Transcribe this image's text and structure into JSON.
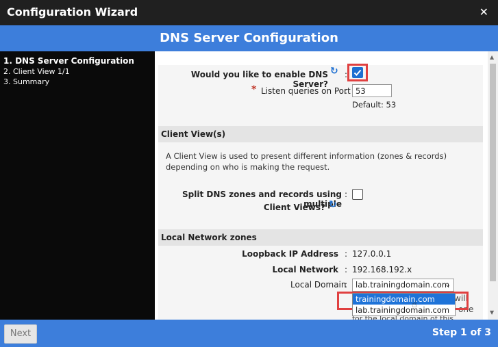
{
  "window": {
    "title": "Configuration Wizard",
    "close_glyph": "✕"
  },
  "header": {
    "title": "DNS Server Configuration"
  },
  "sidebar": {
    "steps": [
      {
        "label": "1.  DNS Server Configuration"
      },
      {
        "label": "2. Client View 1/1"
      },
      {
        "label": "3. Summary"
      }
    ]
  },
  "form": {
    "enable_dns": {
      "label": "Would you like to enable DNS Server?",
      "checked": true,
      "icon": "refresh-icon"
    },
    "port": {
      "label": "Listen queries on Port",
      "value": "53",
      "default_text": "Default: 53",
      "required_mark": "*"
    },
    "client_views": {
      "title": "Client View(s)",
      "description": "A Client View is used to present different information (zones & records) depending on who is making the request."
    },
    "split_dns": {
      "label_line1": "Split DNS zones and records using multiple",
      "label_line2": "Client Views?",
      "checked": false
    },
    "local_zones": {
      "title": "Local Network zones",
      "loopback_label": "Loopback IP Address",
      "loopback_value": "127.0.0.1",
      "network_label": "Local Network",
      "network_value": "192.168.192.x",
      "domain_label": "Local Domain",
      "domain_value": "lab.trainingdomain.com",
      "options": [
        "trainingdomain.com",
        "lab.trainingdomain.com"
      ],
      "hidden_text_1": "will",
      "hidden_text_2": "one",
      "hidden_text_3": "for the local domain of this"
    },
    "colon": ":"
  },
  "footer": {
    "next_label": "Next",
    "step_info": "Step 1 of 3"
  },
  "colors": {
    "accent": "#3d7edb",
    "titlebar": "#202020",
    "highlight": "#e04040"
  }
}
